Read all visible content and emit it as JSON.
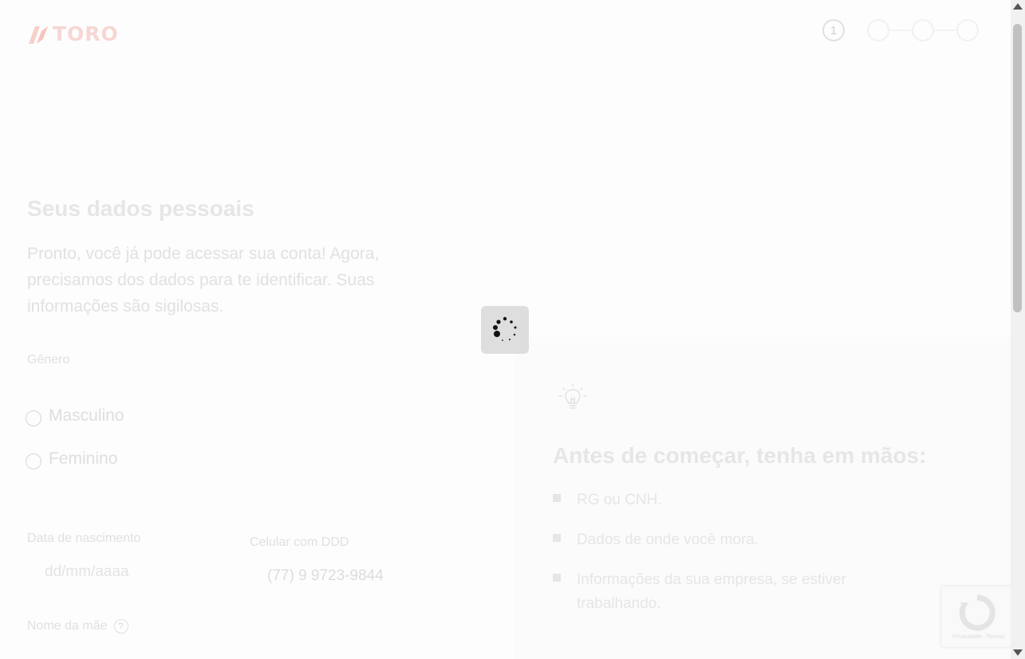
{
  "brand": {
    "name": "TORO",
    "color": "#f2a9a2"
  },
  "stepper": {
    "current": "1",
    "total_steps": 4
  },
  "form": {
    "title": "Seus dados pessoais",
    "intro": "Pronto, você já pode acessar sua conta! Agora, precisamos dos dados para te identificar. Suas informações são sigilosas.",
    "gender_label": "Gênero",
    "gender_options": [
      "Masculino",
      "Feminino"
    ],
    "birthdate_label": "Data de nascimento",
    "birthdate_placeholder": "dd/mm/aaaa",
    "phone_label": "Celular com DDD",
    "phone_value": "(77) 9 9723-9844",
    "mother_name_label": "Nome da mãe",
    "help_symbol": "?"
  },
  "checklist": {
    "icon": "lightbulb-icon",
    "title": "Antes de começar, tenha em mãos:",
    "items": [
      "RG ou CNH.",
      "Dados de onde você mora.",
      "Informações da sua empresa, se estiver trabalhando."
    ]
  },
  "loader": {
    "state": "loading"
  },
  "recaptcha": {
    "text": "Privacidade - Termos"
  }
}
